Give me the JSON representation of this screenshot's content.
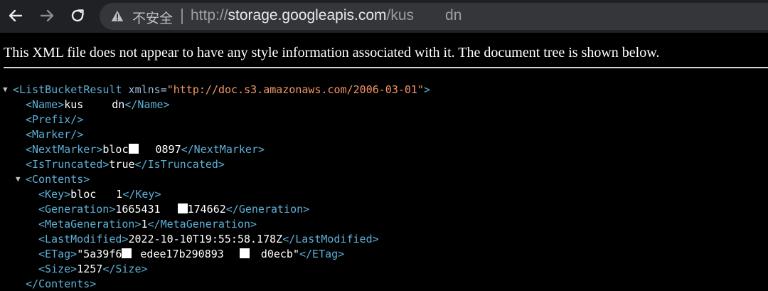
{
  "browser": {
    "back_icon": "arrow-left-icon",
    "forward_icon": "arrow-right-icon",
    "reload_icon": "reload-icon",
    "security_icon": "warning-triangle-icon",
    "security_label": "不安全",
    "url_scheme": "http://",
    "url_host": "storage.googleapis.com",
    "url_path_start": "/kus",
    "url_path_end": "dn"
  },
  "viewer": {
    "info_message": "This XML file does not appear to have any style information associated with it. The document tree is shown below."
  },
  "xml": {
    "root_open": "<ListBucketResult",
    "root_attr_name": " xmlns=",
    "root_attr_value": "\"http://doc.s3.amazonaws.com/2006-03-01\"",
    "root_close_bracket": ">",
    "name_open": "<Name>",
    "name_value_start": "kus",
    "name_value_end": "dn",
    "name_close": "</Name>",
    "prefix": "<Prefix/>",
    "marker": "<Marker/>",
    "nextmarker_open": "<NextMarker>",
    "nextmarker_value_start": "bloc",
    "nextmarker_value_end": "0897",
    "nextmarker_close": "</NextMarker>",
    "istruncated_open": "<IsTruncated>",
    "istruncated_value": "true",
    "istruncated_close": "</IsTruncated>",
    "contents_open": "<Contents>",
    "key_open": "<Key>",
    "key_value_start": "bloc",
    "key_value_end": "1",
    "key_close": "</Key>",
    "generation_open": "<Generation>",
    "generation_value_start": "1665431",
    "generation_value_end": "174662",
    "generation_close": "</Generation>",
    "metageneration_open": "<MetaGeneration>",
    "metageneration_value": "1",
    "metageneration_close": "</MetaGeneration>",
    "lastmodified_open": "<LastModified>",
    "lastmodified_value": "2022-10-10T19:55:58.178Z",
    "lastmodified_close": "</LastModified>",
    "etag_open": "<ETag>",
    "etag_value_start": "\"5a39f6",
    "etag_value_mid": "edee17b290893",
    "etag_value_end": "d0ecb\"",
    "etag_close": "</ETag>",
    "size_open": "<Size>",
    "size_value": "1257",
    "size_close": "</Size>",
    "contents_close": "</Contents>"
  }
}
